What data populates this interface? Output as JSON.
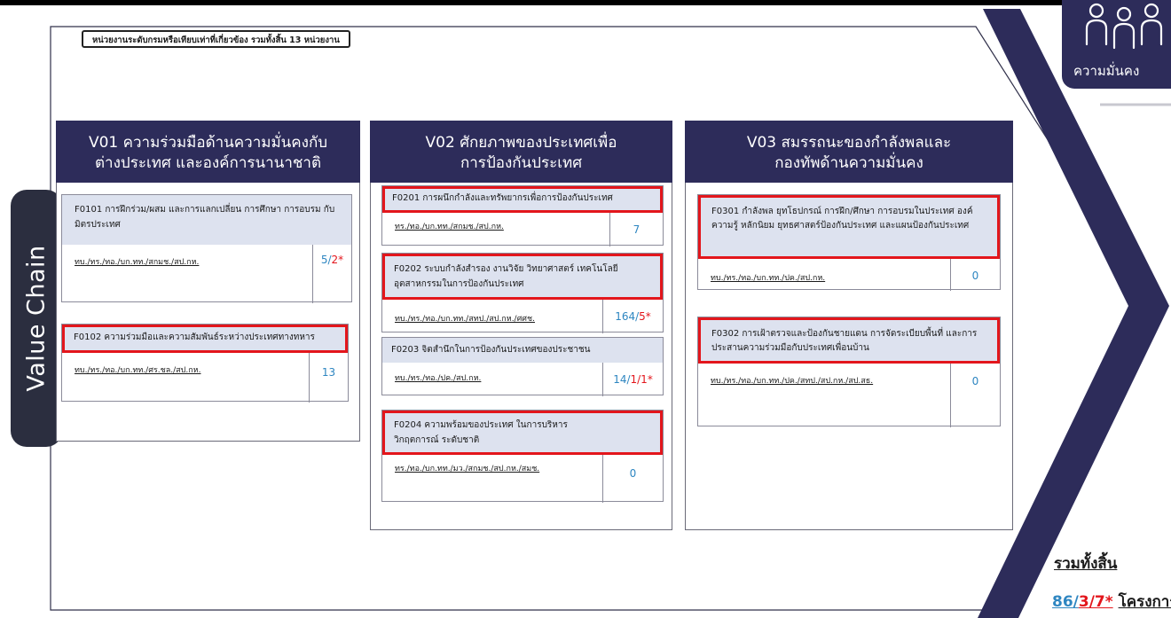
{
  "header": {
    "unit_note": "หน่วยงานระดับกรมหรือเทียบเท่าที่เกี่ยวข้อง รวมทั้งสิ้น 13 หน่วยงาน",
    "side_tab": "Value Chain",
    "icon_label": "ความมั่นคง"
  },
  "columns": [
    {
      "title_line1": "V01 ความร่วมมือด้านความมั่นคงกับ",
      "title_line2": "ต่างประเทศ และองค์การนานาชาติ",
      "items": [
        {
          "title": "F0101 การฝึกร่วม/ผสม และการแลกเปลี่ยน การศึกษา การอบรม กับมิตรประเทศ",
          "agency": "ทบ./ทร./ทอ./บก.ทท./สกมช./สป.กห.",
          "count_main": "5/",
          "count_red": "2*"
        },
        {
          "title": "F0102 ความร่วมมือและความสัมพันธ์ระหว่างประเทศทางทหาร",
          "agency": "ทบ./ทร./ทอ./บก.ทท./ศร.ชล./สป.กห.",
          "count_main": "13",
          "count_red": ""
        }
      ]
    },
    {
      "title_line1": "V02 ศักยภาพของประเทศเพื่อ",
      "title_line2": "การป้องกันประเทศ",
      "items": [
        {
          "title": "F0201 การผนึกกำลังและทรัพยากรเพื่อการป้องกันประเทศ",
          "agency": "ทร./ทอ./บก.ทท./สกมช./สป.กห.",
          "count_main": "7",
          "count_red": ""
        },
        {
          "title": "F0202 ระบบกำลังสำรอง งานวิจัย วิทยาศาสตร์ เทคโนโลยีอุตสาหกรรมในการป้องกันประเทศ",
          "agency": "ทบ./ทร./ทอ./บก.ทท./สทป./สป.กห./ศศช.",
          "count_main": "164/",
          "count_red": "5*"
        },
        {
          "title": "F0203 จิตสำนึกในการป้องกันประเทศของประชาชน",
          "agency": "ทบ./ทร./ทอ./ปค./สป.กห.",
          "count_main": "14/",
          "count_red": "1/1*"
        },
        {
          "title": "F0204 ความพร้อมของประเทศ ในการบริหารวิกฤตการณ์ ระดับชาติ",
          "agency": "ทร./ทอ./บก.ทท./มว./สกมช./สป.กห./สมช.",
          "count_main": "0",
          "count_red": ""
        }
      ]
    },
    {
      "title_line1": "V03 สมรรถนะของกำลังพลและ",
      "title_line2": "กองทัพด้านความมั่นคง",
      "items": [
        {
          "title": "F0301 กำลังพล ยุทโธปกรณ์ การฝึก/ศึกษา การอบรมในประเทศ องค์ความรู้ หลักนิยม ยุทธศาสตร์ป้องกันประเทศ และแผนป้องกันประเทศ",
          "agency": "ทบ./ทร./ทอ./บก.ทท./ปค./สป.กห.",
          "count_main": "0",
          "count_red": ""
        },
        {
          "title": "F0302 การเฝ้าตรวจและป้องกันชายแดน การจัดระเบียบพื้นที่ และการประสานความร่วมมือกับประเทศเพื่อนบ้าน",
          "agency": "ทบ./ทร./ทอ./บก.ทท./ปค./สทป./สป.กห./สป.สธ.",
          "count_main": "0",
          "count_red": ""
        }
      ]
    }
  ],
  "total": {
    "label": "รวมทั้งสิ้น",
    "value_a": "86/",
    "value_b": "3/7*",
    "unit": "โครงการ"
  }
}
